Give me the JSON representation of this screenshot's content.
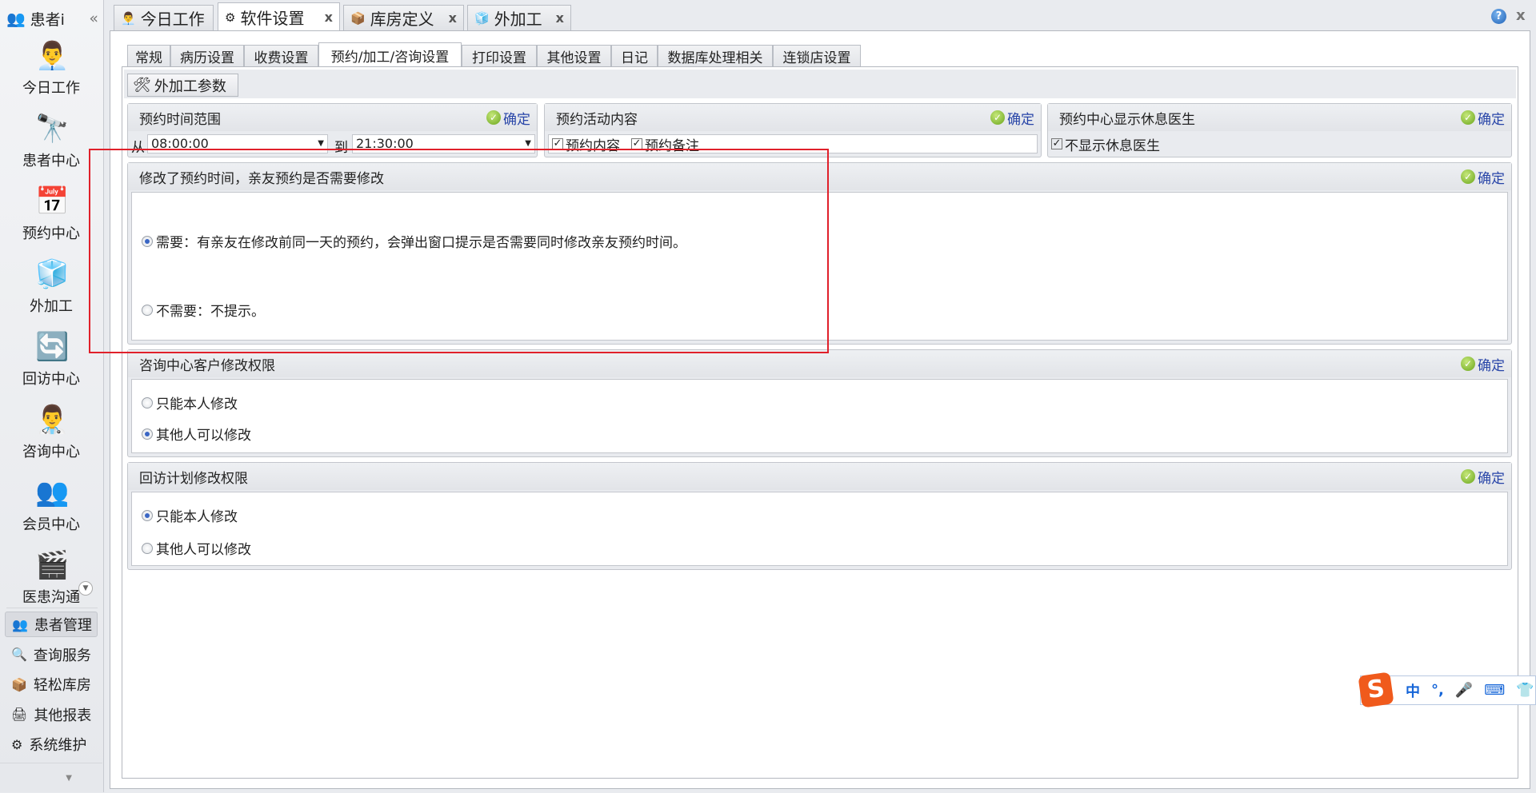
{
  "sidebar": {
    "header": "患者i",
    "collapse": "«",
    "big_items": [
      {
        "label": "今日工作",
        "icon": "desk-person-icon"
      },
      {
        "label": "患者中心",
        "icon": "binoculars-icon"
      },
      {
        "label": "预约中心",
        "icon": "calendar-icon"
      },
      {
        "label": "外加工",
        "icon": "cubes-icon"
      },
      {
        "label": "回访中心",
        "icon": "refresh-icon"
      },
      {
        "label": "咨询中心",
        "icon": "consultant-icon"
      },
      {
        "label": "会员中心",
        "icon": "members-icon"
      },
      {
        "label": "医患沟通",
        "icon": "video-icon"
      }
    ],
    "small_items": [
      {
        "label": "患者管理",
        "icon": "users-icon",
        "active": true
      },
      {
        "label": "查询服务",
        "icon": "search-doc-icon"
      },
      {
        "label": "轻松库房",
        "icon": "box-cart-icon"
      },
      {
        "label": "其他报表",
        "icon": "printer-icon"
      },
      {
        "label": "系统维护",
        "icon": "gears-icon"
      }
    ]
  },
  "doc_tabs": [
    {
      "label": "今日工作",
      "closable": false
    },
    {
      "label": "软件设置",
      "closable": true,
      "active": true
    },
    {
      "label": "库房定义",
      "closable": true
    },
    {
      "label": "外加工",
      "closable": true
    }
  ],
  "close_symbol": "x",
  "help_symbol": "?",
  "sub_tabs": [
    "常规",
    "病历设置",
    "收费设置",
    "预约/加工/咨询设置",
    "打印设置",
    "其他设置",
    "日记",
    "数据库处理相关",
    "连锁店设置"
  ],
  "active_sub_tab": "预约/加工/咨询设置",
  "toolbar": {
    "button": "外加工参数"
  },
  "ok_label": "确定",
  "time_range": {
    "title": "预约时间范围",
    "from_label": "从",
    "from": "08:00:00",
    "to_label": "到",
    "to": "21:30:00"
  },
  "activity": {
    "title": "预约活动内容",
    "options": [
      {
        "label": "预约内容",
        "checked": true
      },
      {
        "label": "预约备注",
        "checked": true
      }
    ]
  },
  "rest_doctor": {
    "title": "预约中心显示休息医生",
    "option": {
      "label": "不显示休息医生",
      "checked": true
    }
  },
  "relative": {
    "title": "修改了预约时间，亲友预约是否需要修改",
    "options": [
      {
        "label": "需要：有亲友在修改前同一天的预约，会弹出窗口提示是否需要同时修改亲友预约时间。",
        "selected": true
      },
      {
        "label": "不需要：不提示。",
        "selected": false
      }
    ]
  },
  "consult": {
    "title": "咨询中心客户修改权限",
    "options": [
      {
        "label": "只能本人修改",
        "selected": false
      },
      {
        "label": "其他人可以修改",
        "selected": true
      }
    ]
  },
  "revisit": {
    "title": "回访计划修改权限",
    "options": [
      {
        "label": "只能本人修改",
        "selected": true
      },
      {
        "label": "其他人可以修改",
        "selected": false
      }
    ]
  },
  "ime": {
    "logo": "S",
    "items": [
      "中",
      "°,",
      "🎤",
      "⌨",
      "👕",
      "⁘"
    ]
  },
  "colors": {
    "accent": "#2845a8",
    "highlight": "#e0202a",
    "ime": "#1565d8"
  }
}
